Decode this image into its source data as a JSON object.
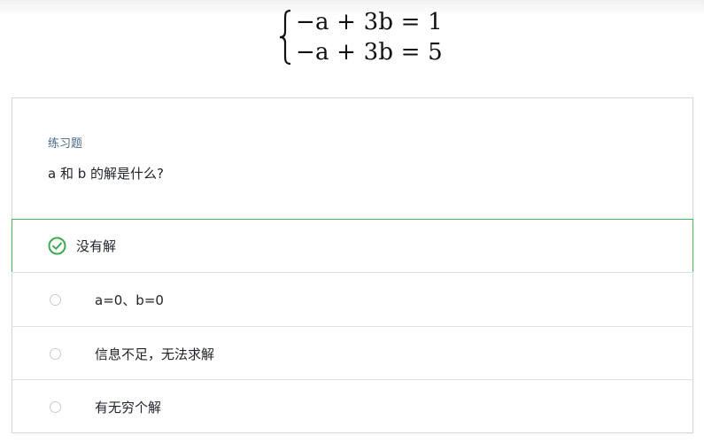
{
  "equation": {
    "line1": "−a + 3b = 1",
    "line2": "−a + 3b = 5"
  },
  "exercise": {
    "label": "练习题",
    "question": "a 和 b 的解是什么?"
  },
  "choices": [
    {
      "text": "没有解",
      "selected": true,
      "correct": true
    },
    {
      "text": "a=0、b=0",
      "selected": false
    },
    {
      "text": "信息不足，无法求解",
      "selected": false
    },
    {
      "text": "有无穷个解",
      "selected": false
    }
  ],
  "colors": {
    "correct_border": "#4cb85c",
    "label_blue": "#4a6a8a"
  },
  "icons": {
    "selected": "check-circle-icon",
    "unselected": "radio-circle-icon"
  }
}
